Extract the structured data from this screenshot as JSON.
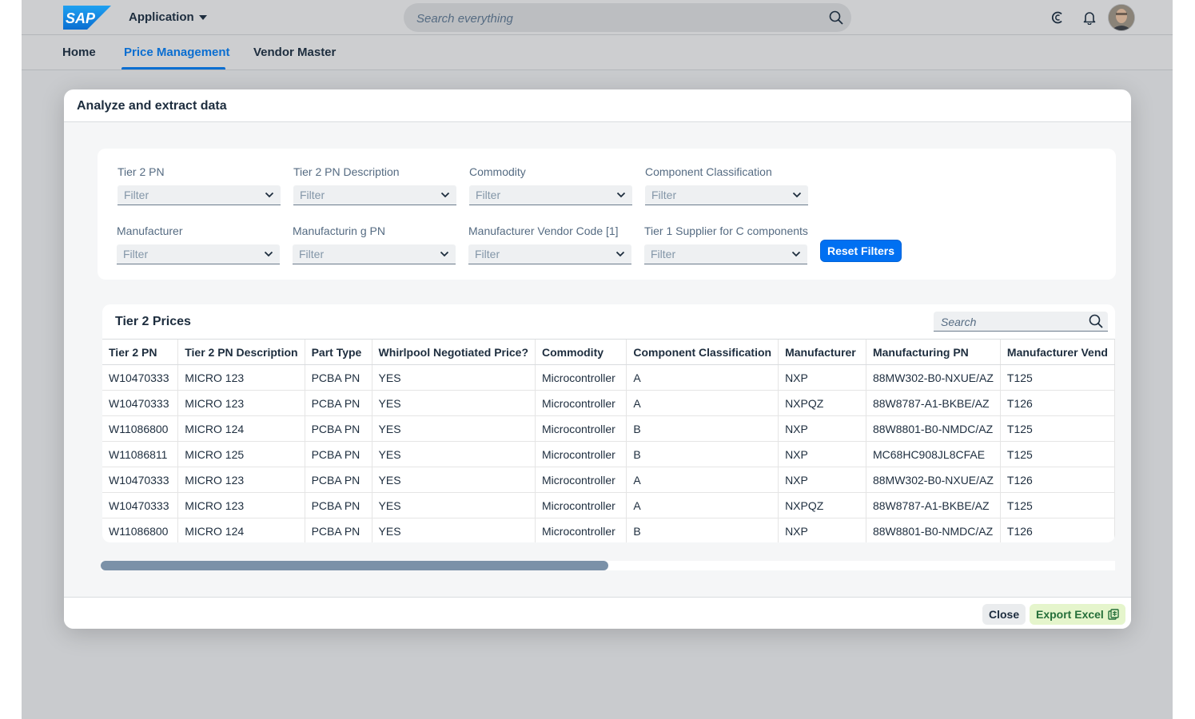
{
  "shell": {
    "logo_text": "SAP",
    "app_title": "Application",
    "search_placeholder": "Search everything"
  },
  "nav": {
    "tabs": [
      {
        "label": "Home"
      },
      {
        "label": "Price Management"
      },
      {
        "label": "Vendor Master"
      }
    ]
  },
  "dialog": {
    "title": "Analyze and extract data",
    "filters": [
      {
        "label": "Tier 2 PN",
        "placeholder": "Filter"
      },
      {
        "label": "Tier 2 PN Description",
        "placeholder": "Filter"
      },
      {
        "label": "Commodity",
        "placeholder": "Filter"
      },
      {
        "label": "Component Classification",
        "placeholder": "Filter"
      },
      {
        "label": "Manufacturer",
        "placeholder": "Filter"
      },
      {
        "label": "Manufacturin g PN",
        "placeholder": "Filter"
      },
      {
        "label": "Manufacturer Vendor Code [1]",
        "placeholder": "Filter"
      },
      {
        "label": "Tier 1 Supplier for C components",
        "placeholder": "Filter"
      }
    ],
    "reset_label": "Reset Filters",
    "table": {
      "title": "Tier 2 Prices",
      "search_placeholder": "Search",
      "columns": [
        "Tier 2 PN",
        "Tier 2 PN Description",
        "Part Type",
        "Whirlpool Negotiated Price?",
        "Commodity",
        "Component Classification",
        "Manufacturer",
        "Manufacturing PN",
        "Manufacturer Vend"
      ],
      "rows": [
        [
          "W10470333",
          "MICRO 123",
          "PCBA PN",
          "YES",
          "Microcontroller",
          "A",
          "NXP",
          "88MW302-B0-NXUE/AZ",
          "T125"
        ],
        [
          "W10470333",
          "MICRO 123",
          "PCBA PN",
          "YES",
          "Microcontroller",
          "A",
          "NXPQZ",
          "88W8787-A1-BKBE/AZ",
          "T126"
        ],
        [
          "W11086800",
          "MICRO 124",
          "PCBA PN",
          "YES",
          "Microcontroller",
          "B",
          "NXP",
          "88W8801-B0-NMDC/AZ",
          "T125"
        ],
        [
          "W11086811",
          "MICRO 125",
          "PCBA PN",
          "YES",
          "Microcontroller",
          "B",
          "NXP",
          "MC68HC908JL8CFAE",
          "T125"
        ],
        [
          "W10470333",
          "MICRO 123",
          "PCBA PN",
          "YES",
          "Microcontroller",
          "A",
          "NXP",
          "88MW302-B0-NXUE/AZ",
          "T126"
        ],
        [
          "W10470333",
          "MICRO 123",
          "PCBA PN",
          "YES",
          "Microcontroller",
          "A",
          "NXPQZ",
          "88W8787-A1-BKBE/AZ",
          "T125"
        ],
        [
          "W11086800",
          "MICRO 124",
          "PCBA PN",
          "YES",
          "Microcontroller",
          "B",
          "NXP",
          "88W8801-B0-NMDC/AZ",
          "T126"
        ]
      ]
    },
    "close_label": "Close",
    "export_label": "Export Excel"
  },
  "colors": {
    "accent": "#0a6ed1",
    "reset_button": "#0070f2",
    "export_button_bg": "#e5f5cc",
    "export_button_text": "#256f3a"
  },
  "icons": [
    "search-icon",
    "caret-down-icon",
    "copilot-icon",
    "bell-icon",
    "chevron-down-icon",
    "excel-icon"
  ]
}
